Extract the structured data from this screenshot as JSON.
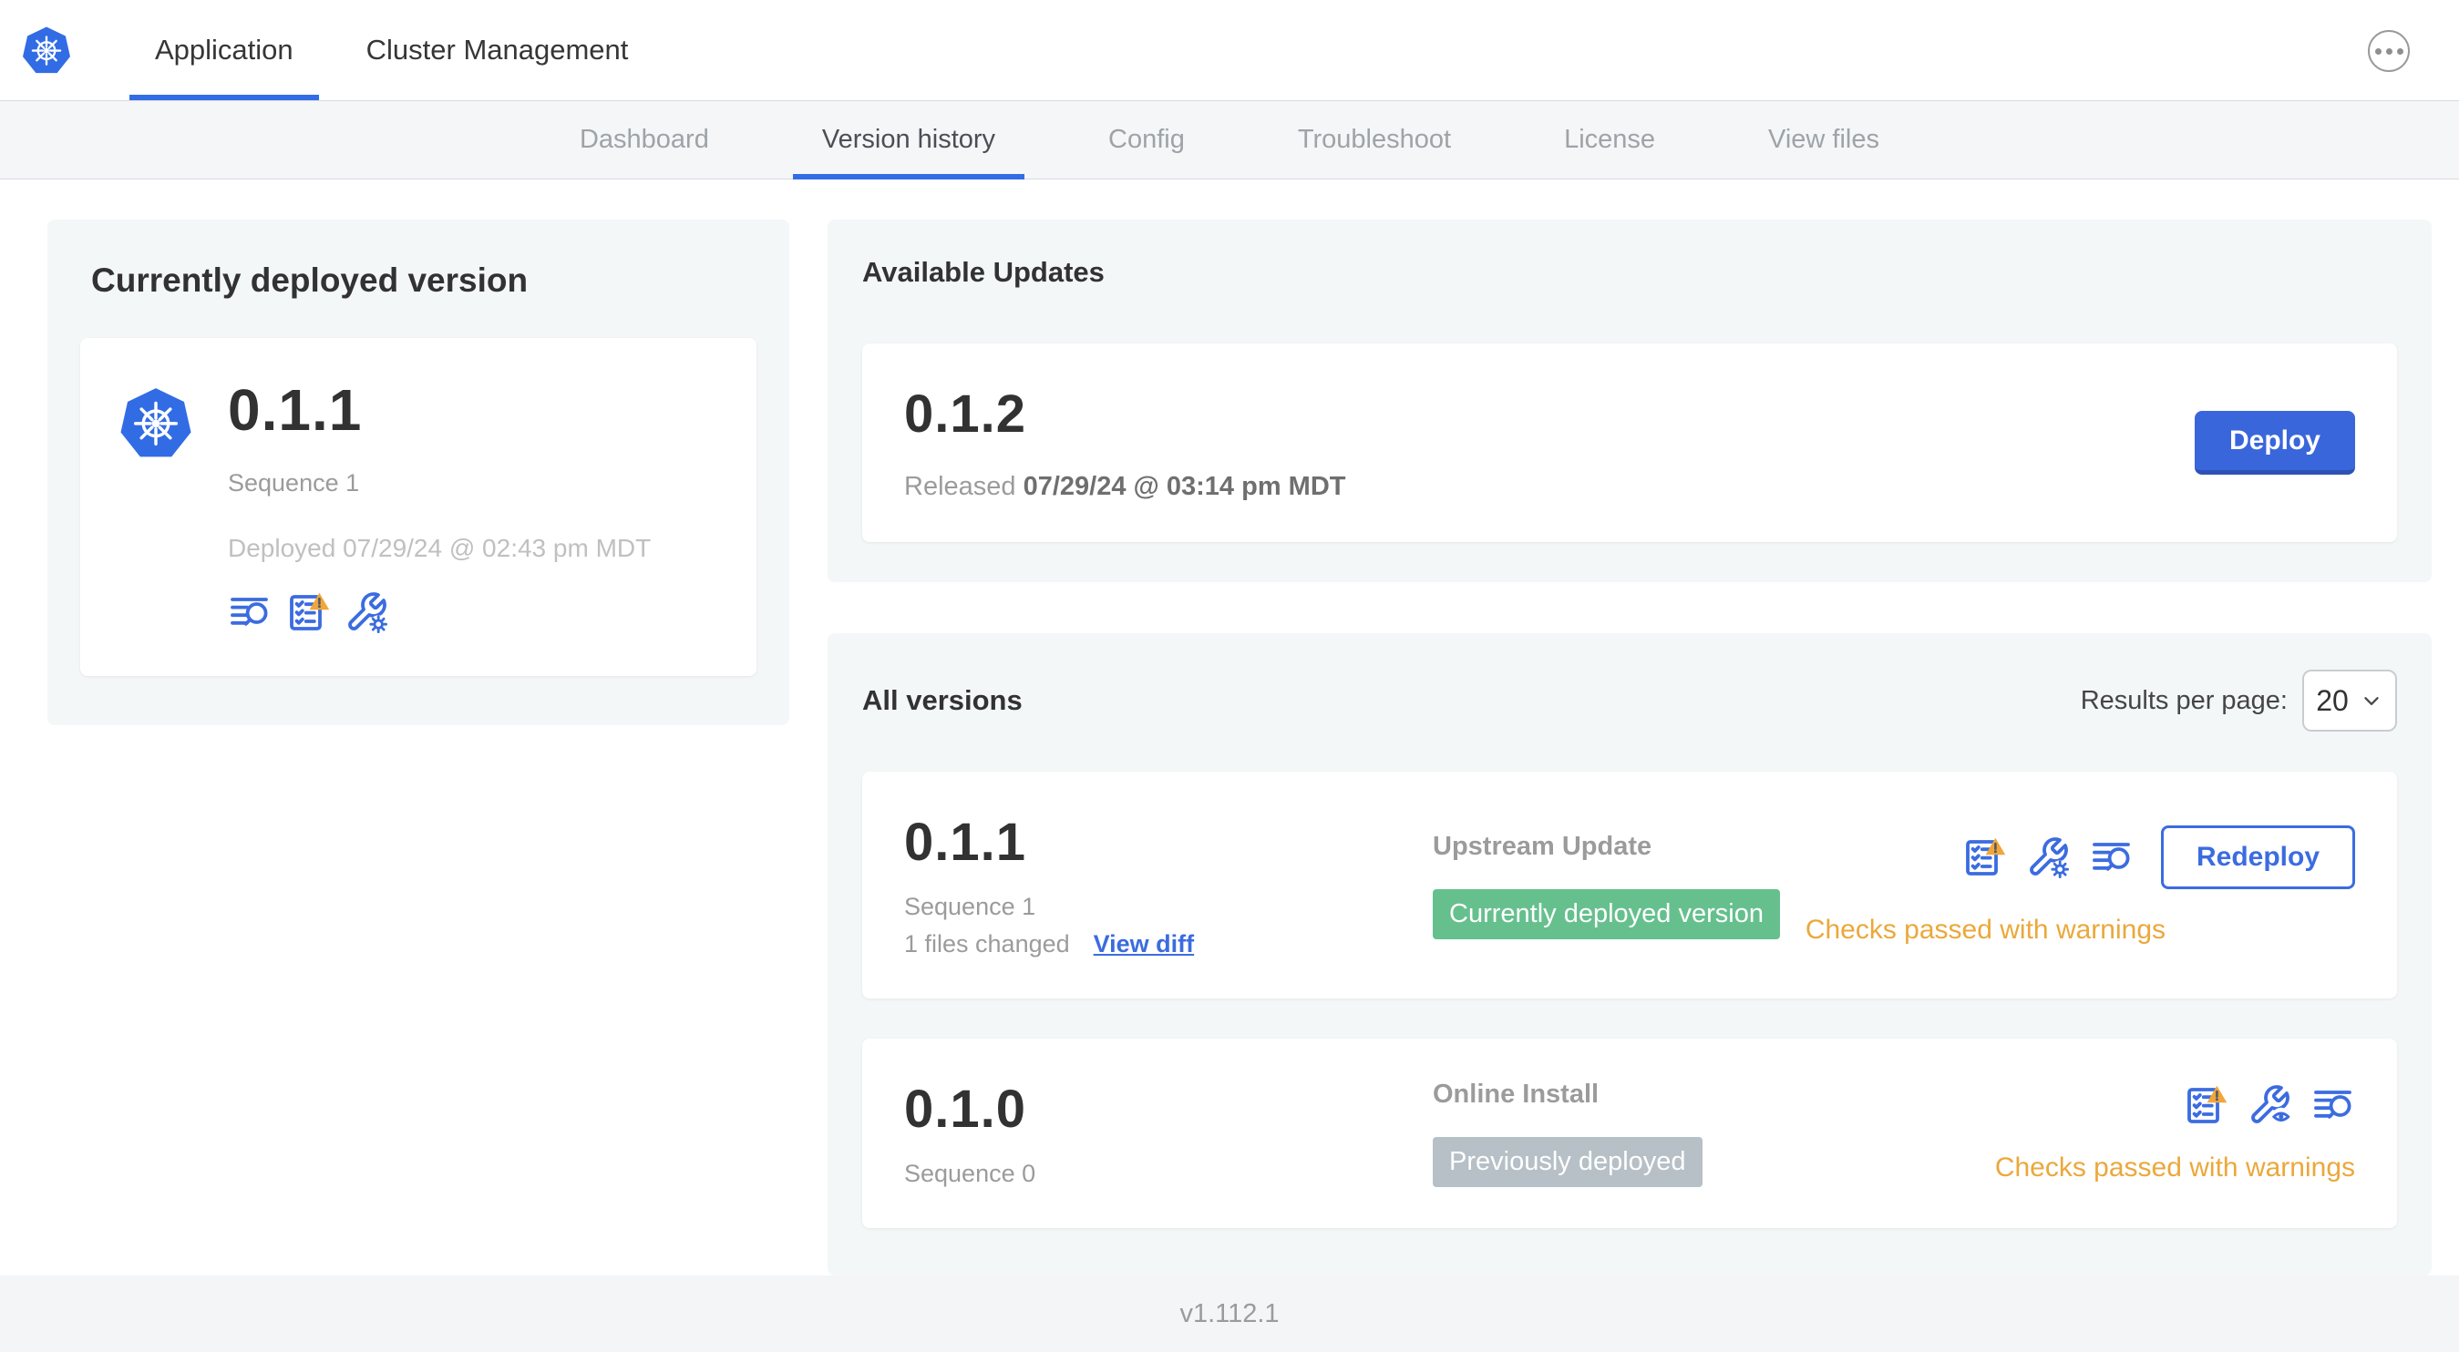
{
  "header": {
    "tabs": [
      {
        "label": "Application",
        "active": true
      },
      {
        "label": "Cluster Management",
        "active": false
      }
    ],
    "more_icon": "ellipsis-icon"
  },
  "subnav": {
    "tabs": [
      {
        "label": "Dashboard",
        "active": false
      },
      {
        "label": "Version history",
        "active": true
      },
      {
        "label": "Config",
        "active": false
      },
      {
        "label": "Troubleshoot",
        "active": false
      },
      {
        "label": "License",
        "active": false
      },
      {
        "label": "View files",
        "active": false
      }
    ]
  },
  "deployed": {
    "title": "Currently deployed version",
    "version": "0.1.1",
    "sequence": "Sequence 1",
    "deployed_at": "Deployed 07/29/24 @ 02:43 pm MDT",
    "icons": [
      "release-notes-icon",
      "preflight-checks-warning-icon",
      "edit-config-icon"
    ]
  },
  "updates": {
    "title": "Available Updates",
    "version": "0.1.2",
    "released_prefix": "Released",
    "released_at": "07/29/24 @ 03:14 pm MDT",
    "deploy_label": "Deploy"
  },
  "versions": {
    "title": "All versions",
    "results_per_page_label": "Results per page:",
    "results_per_page_value": "20",
    "rows": [
      {
        "version": "0.1.1",
        "sequence": "Sequence 1",
        "files_changed": "1 files changed",
        "view_diff": "View diff",
        "source": "Upstream Update",
        "badge": "Currently deployed version",
        "badge_color": "#66C08D",
        "status": "Checks passed with warnings",
        "action": "Redeploy",
        "icons": [
          "preflight-checks-warning-icon",
          "edit-config-icon",
          "release-notes-icon"
        ]
      },
      {
        "version": "0.1.0",
        "sequence": "Sequence 0",
        "source": "Online Install",
        "badge": "Previously deployed",
        "badge_color": "#B6C0C6",
        "status": "Checks passed with warnings",
        "icons": [
          "preflight-checks-warning-icon",
          "view-config-icon",
          "release-notes-icon"
        ]
      }
    ]
  },
  "footer": {
    "app_version": "v1.112.1"
  },
  "colors": {
    "accent_blue": "#3B6CE0",
    "logo_blue": "#326CE5",
    "active_tab_underline": "#326DE6",
    "badge_green": "#66C08D",
    "badge_gray": "#B6C0C6",
    "warning_yellow": "#EBA83B"
  }
}
